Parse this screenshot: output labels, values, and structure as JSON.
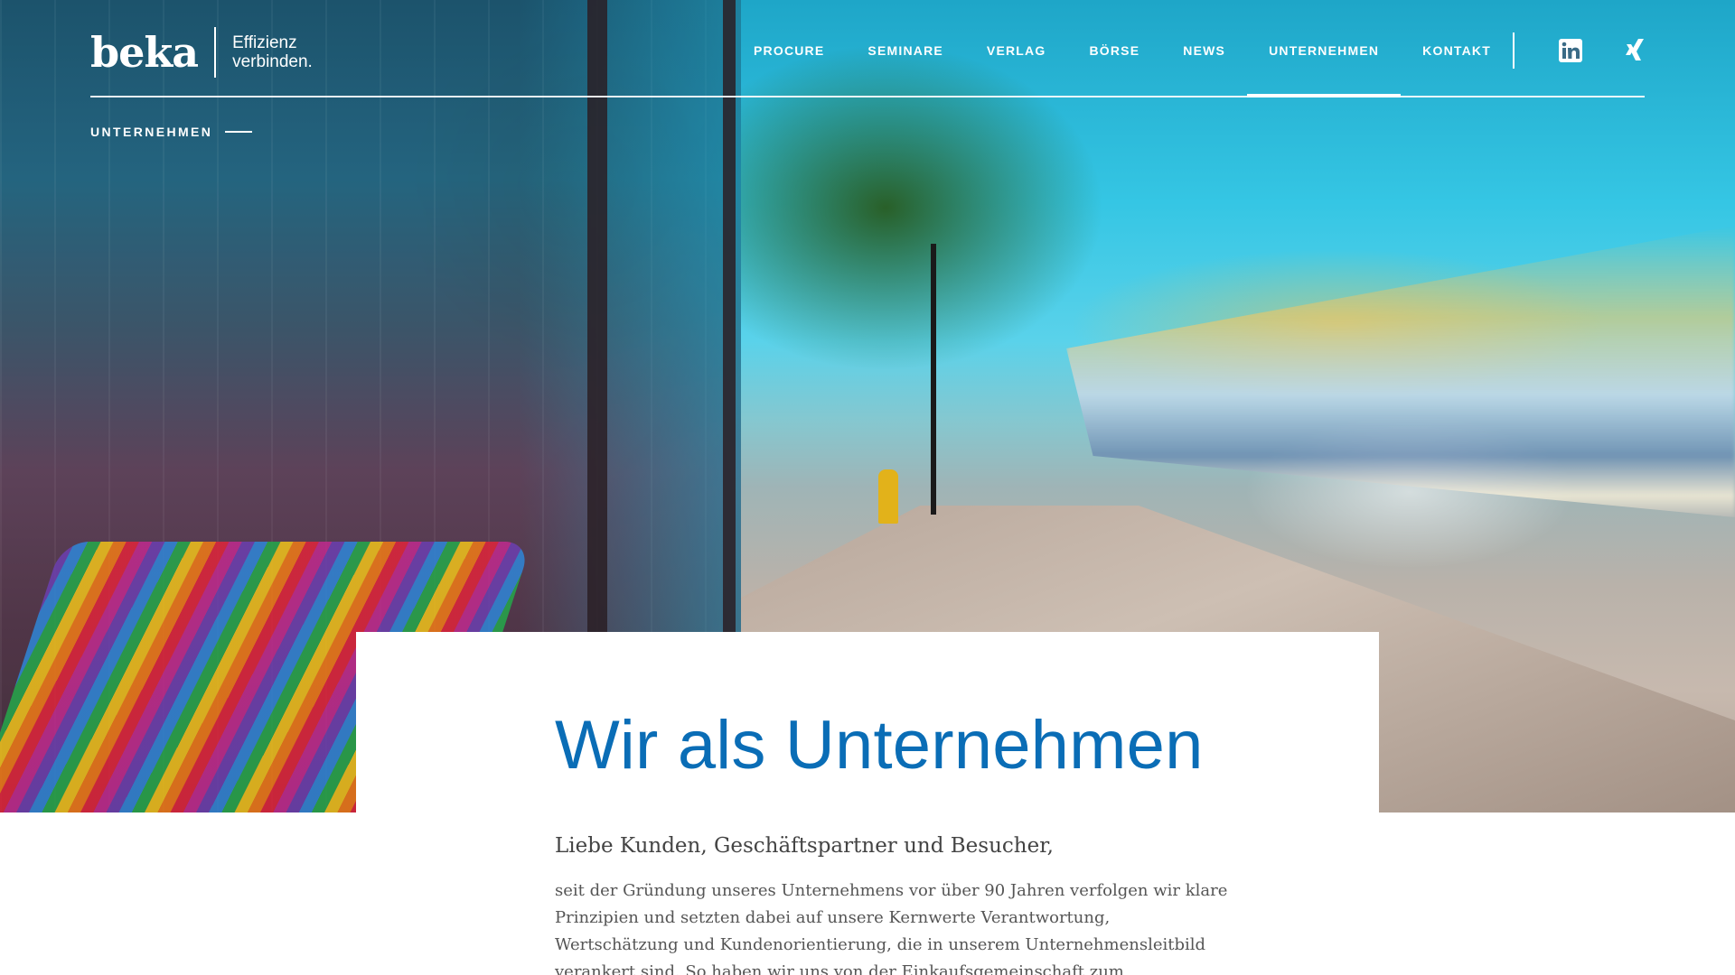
{
  "brand": {
    "logo_word": "beka",
    "tagline_line1": "Effizienz",
    "tagline_line2": "verbinden."
  },
  "nav": {
    "items": [
      {
        "label": "PROCURE"
      },
      {
        "label": "SEMINARE"
      },
      {
        "label": "VERLAG"
      },
      {
        "label": "BÖRSE"
      },
      {
        "label": "NEWS"
      },
      {
        "label": "UNTERNEHMEN",
        "active": true
      },
      {
        "label": "KONTAKT"
      }
    ],
    "social": [
      {
        "icon": "linkedin-icon"
      },
      {
        "icon": "xing-icon"
      }
    ]
  },
  "breadcrumb": {
    "label": "UNTERNEHMEN"
  },
  "content": {
    "headline": "Wir als Unternehmen",
    "greeting": "Liebe Kunden, Geschäftspartner und Besucher,",
    "body_lines": [
      "seit der Gründung unseres Unternehmens vor über 90 Jahren verfolgen wir klare",
      "Prinzipien und setzten dabei auf unsere Kernwerte Verantwortung,",
      "Wertschätzung und Kundenorientierung, die in unserem Unternehmensleitbild",
      "verankert sind. So haben wir uns von der Einkaufsgemeinschaft zum"
    ]
  },
  "colors": {
    "headline_blue": "#0a6db6",
    "nav_text": "#ffffff",
    "body_text": "#555555"
  }
}
